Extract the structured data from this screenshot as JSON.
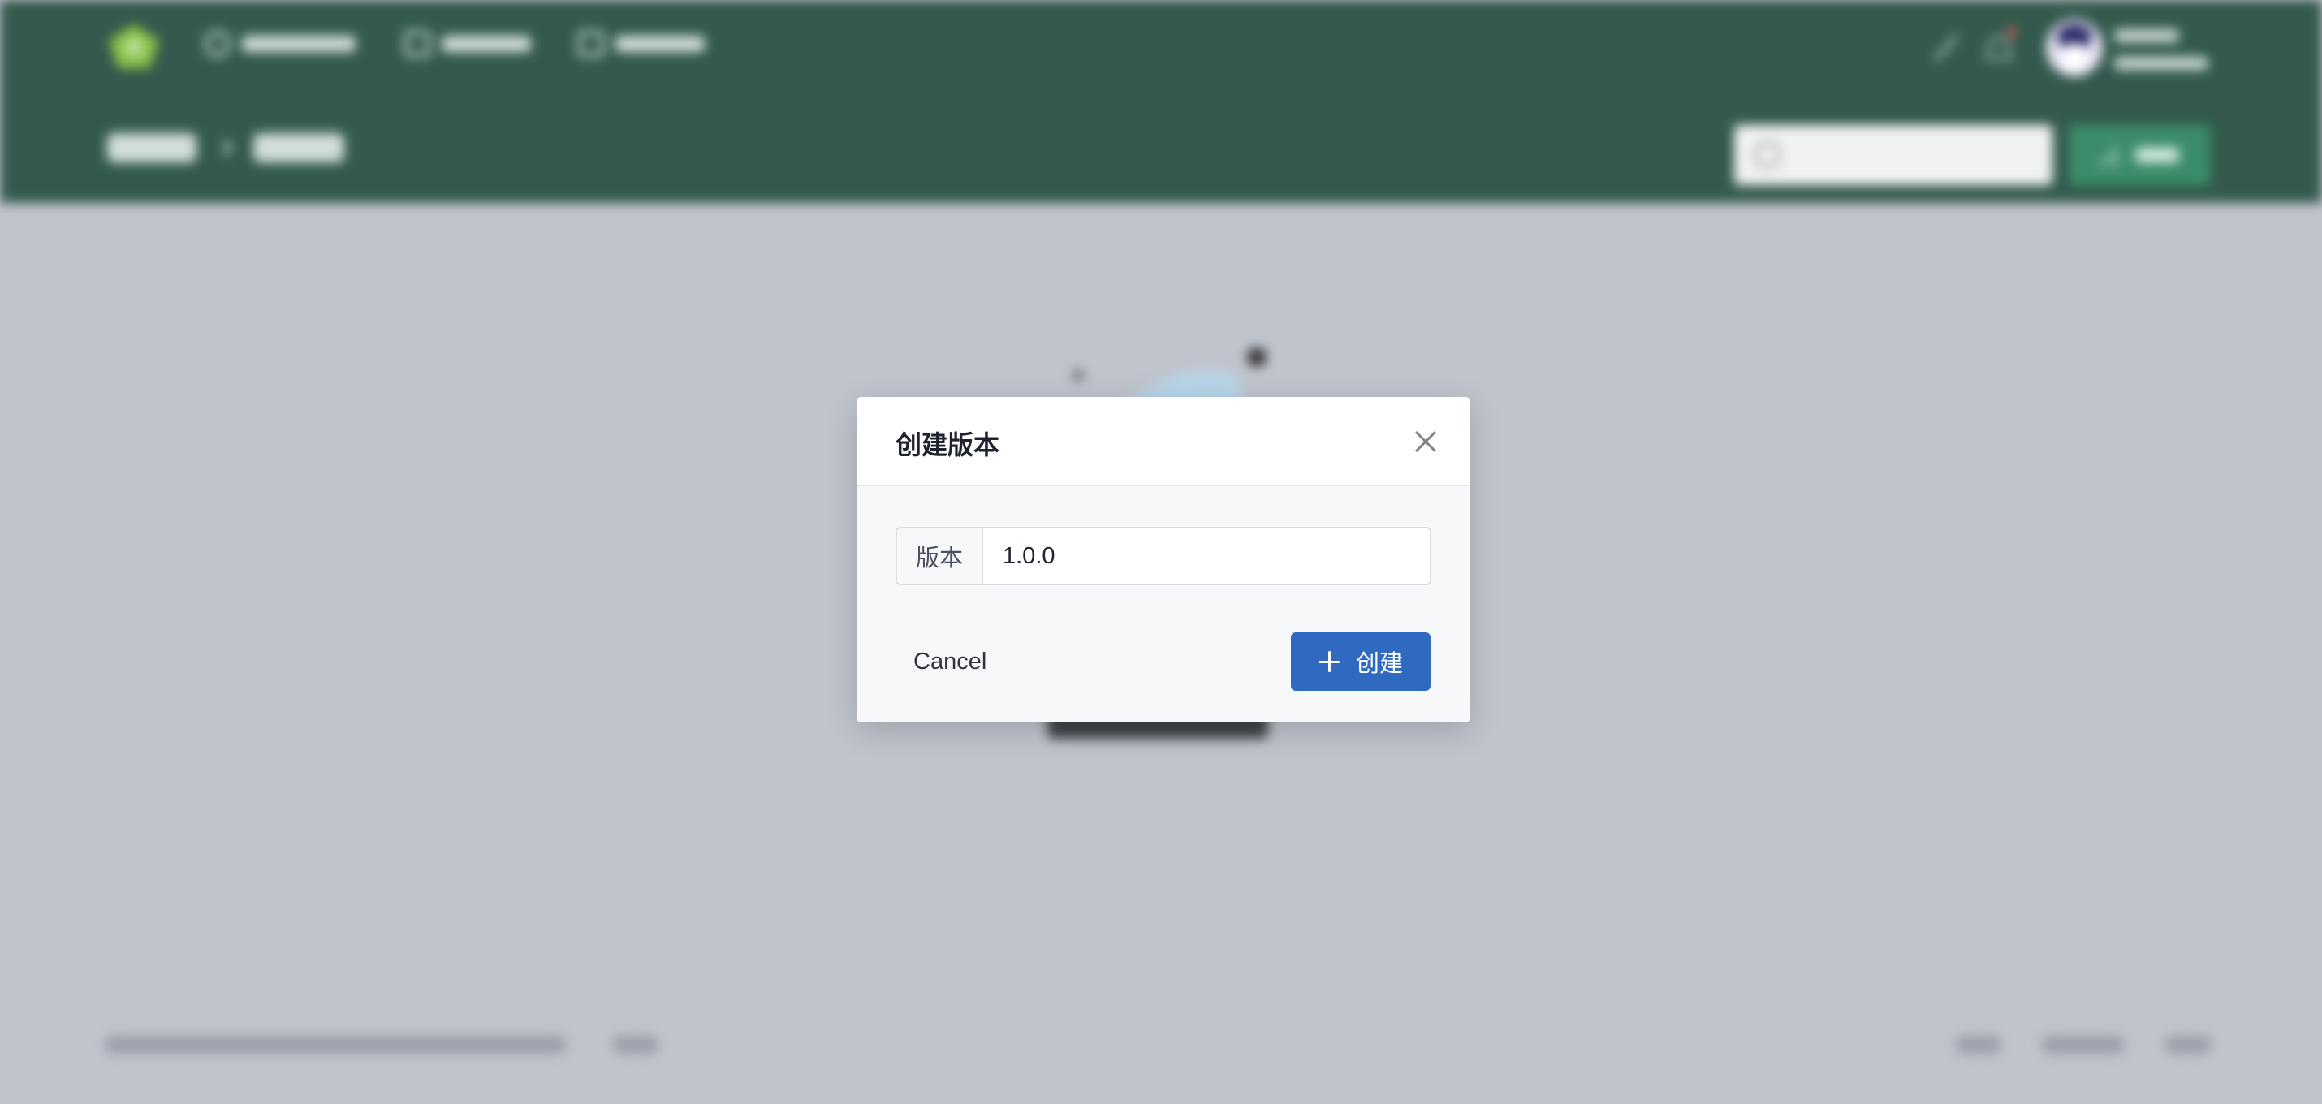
{
  "modal": {
    "title": "创建版本",
    "field_label": "版本",
    "version_value": "1.0.0",
    "cancel_label": "Cancel",
    "create_label": "创建"
  },
  "colors": {
    "topbar": "#335a4d",
    "primary_button": "#2f6ac0",
    "overlay_background": "#c0c4cc",
    "modal_background": "#f7f8fa"
  },
  "icons": [
    "close-icon",
    "plus-icon"
  ]
}
